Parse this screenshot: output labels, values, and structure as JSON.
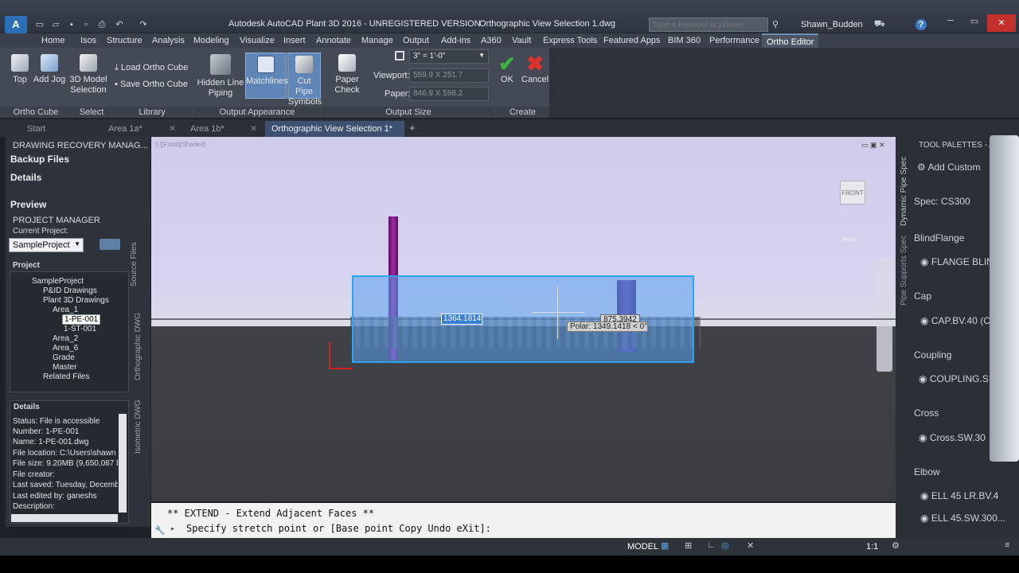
{
  "window": {
    "title": "Autodesk AutoCAD Plant 3D 2016 - UNREGISTERED VERSION",
    "file": "Orthographic View Selection 1.dwg",
    "search_placeholder": "Type a keyword or phrase",
    "user": "Shawn_Budden"
  },
  "menu": [
    "Home",
    "Isos",
    "Structure",
    "Analysis",
    "Modeling",
    "Visualize",
    "Insert",
    "Annotate",
    "Manage",
    "Output",
    "Add-ins",
    "A360",
    "Vault",
    "Express Tools",
    "Featured Apps",
    "BIM 360",
    "Performance",
    "Ortho Editor"
  ],
  "ribbon": {
    "top": "Top",
    "add_jog": "Add Jog",
    "model_selection": "3D Model Selection",
    "load_cube": "Load Ortho Cube",
    "save_cube": "Save Ortho Cube",
    "hidden_line": "Hidden Line Piping",
    "matchlines": "Matchlines",
    "cut_pipe": "Cut Pipe Symbols",
    "paper_check": "Paper Check",
    "scale": "3\" = 1'-0\"",
    "viewport_label": "Viewport:",
    "viewport_value": "559.9 X 251.7",
    "paper_label": "Paper:",
    "paper_value": "846.9 X 598.2",
    "ok": "OK",
    "cancel": "Cancel",
    "groups": [
      "Ortho Cube",
      "Select",
      "Library",
      "Output Appearance",
      "Output Size",
      "Create"
    ]
  },
  "tabs": [
    "Start",
    "Area 1a*",
    "Area 1b*",
    "Orthographic View Selection 1*"
  ],
  "left": {
    "drm_title": "DRAWING RECOVERY MANAG...",
    "backup": "Backup Files",
    "details": "Details",
    "preview": "Preview",
    "pm_title": "PROJECT MANAGER",
    "current_project_label": "Current Project:",
    "current_project": "SampleProject",
    "project_label": "Project",
    "tree": [
      "SampleProject",
      "P&ID Drawings",
      "Plant 3D Drawings",
      "Area_1",
      "1-PE-001",
      "1-ST-001",
      "Area_2",
      "Area_6",
      "Grade",
      "Master",
      "Related Files"
    ],
    "side_tabs": [
      "Source Files",
      "Orthographic DWG",
      "Isometric DWG"
    ],
    "details_title": "Details",
    "details_lines": [
      "Status: File is accessible",
      "Number: 1-PE-001",
      "Name: 1-PE-001.dwg",
      "File location: C:\\Users\\shawn",
      "File size: 9.20MB (9,650,087 b",
      "File creator:",
      "Last saved: Tuesday, Decemb",
      "Last edited by: ganeshs",
      "Description:"
    ]
  },
  "viewport": {
    "label": "[-][Front][Shaded]",
    "viewcube": "FRONT",
    "wcs": "WCS",
    "dim_input": "1364.1814",
    "dim2": "875.3942",
    "polar": "Polar: 1349.1418 < 0°"
  },
  "command": {
    "history": "** EXTEND - Extend Adjacent Faces **",
    "prompt": "Specify stretch point or [Base point Copy Undo eXit]:"
  },
  "palette": {
    "title": "TOOL PALETTES - A",
    "add_custom": "Add Custom",
    "spec": "Spec: CS300",
    "side_tabs": [
      "Dynamic Pipe Spec",
      "Pipe Supports Spec"
    ],
    "items": [
      {
        "cat": "BlindFlange",
        "item": "FLANGE BLIN"
      },
      {
        "cat": "Cap",
        "item": "CAP.BV.40 (C"
      },
      {
        "cat": "Coupling",
        "item": "COUPLING.S"
      },
      {
        "cat": "Cross",
        "item": "Cross.SW.30"
      },
      {
        "cat": "Elbow",
        "item": "ELL 45 LR.BV.4"
      }
    ],
    "extra": "ELL 45.SW.300..."
  },
  "status": {
    "model": "MODEL",
    "scale": "1:1"
  }
}
